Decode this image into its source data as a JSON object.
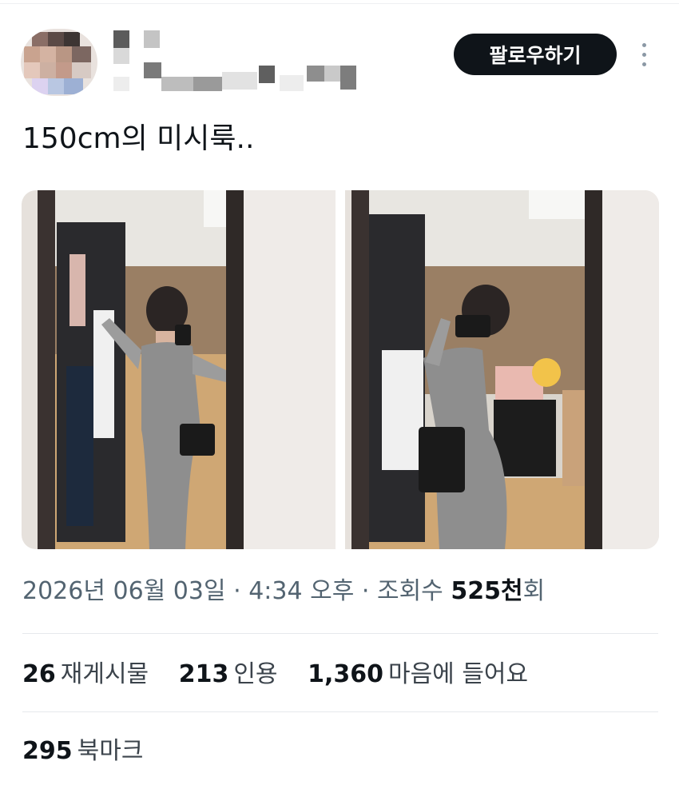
{
  "header": {
    "follow_label": "팔로우하기",
    "avatar_icon": "pixelated-avatar-icon",
    "more_icon": "more-vertical-icon"
  },
  "tweet": {
    "text": "150cm의 미시룩.."
  },
  "media": {
    "photos": [
      {
        "name": "mirror-selfie-front"
      },
      {
        "name": "mirror-selfie-side"
      }
    ]
  },
  "meta": {
    "date": "2026년 06월 03일",
    "separator": "·",
    "time": "4:34 오후",
    "views_label_prefix": "조회수",
    "views_count": "525천",
    "views_suffix": "회"
  },
  "stats": {
    "reposts": {
      "count": "26",
      "label": "재게시물"
    },
    "quotes": {
      "count": "213",
      "label": "인용"
    },
    "likes": {
      "count": "1,360",
      "label": "마음에 들어요"
    },
    "bookmarks": {
      "count": "295",
      "label": "북마크"
    }
  },
  "colors": {
    "follow_bg": "#0f1419",
    "secondary_text": "#536471",
    "divider": "#e6e9ec"
  }
}
